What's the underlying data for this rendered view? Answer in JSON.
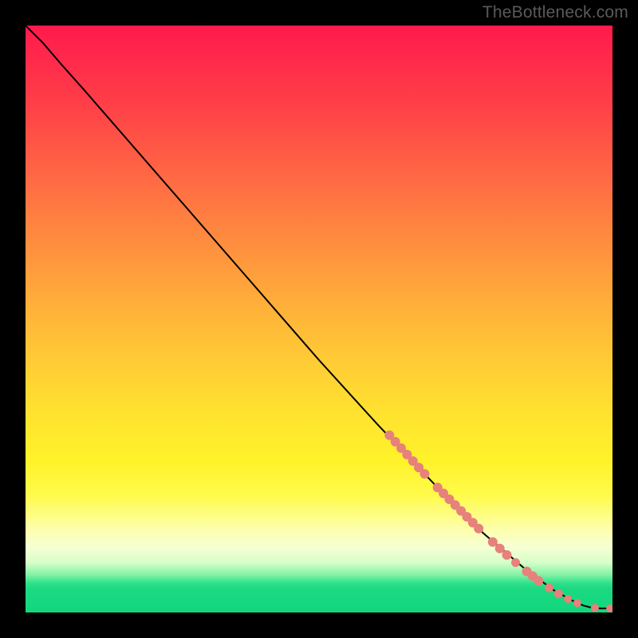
{
  "watermark_text": "TheBottleneck.com",
  "chart_data": {
    "type": "line",
    "title": "",
    "xlabel": "",
    "ylabel": "",
    "xlim": [
      0,
      100
    ],
    "ylim": [
      0,
      100
    ],
    "series": [
      {
        "name": "curve",
        "x": [
          0,
          3,
          6,
          10,
          20,
          30,
          40,
          50,
          60,
          70,
          78,
          85,
          90,
          93,
          95,
          96.5,
          98,
          100
        ],
        "y": [
          100,
          97,
          93.5,
          89,
          77.5,
          66,
          54.5,
          43,
          32,
          21.5,
          13.5,
          7.5,
          3.8,
          2.1,
          1.2,
          0.8,
          0.7,
          0.7
        ]
      }
    ],
    "points": {
      "name": "highlighted-points",
      "color": "#e6817b",
      "data": [
        {
          "x": 62.0,
          "y": 30.2,
          "r": 6
        },
        {
          "x": 63.0,
          "y": 29.1,
          "r": 6
        },
        {
          "x": 64.0,
          "y": 28.0,
          "r": 6
        },
        {
          "x": 65.0,
          "y": 26.9,
          "r": 6
        },
        {
          "x": 66.0,
          "y": 25.8,
          "r": 6
        },
        {
          "x": 67.0,
          "y": 24.7,
          "r": 6
        },
        {
          "x": 68.0,
          "y": 23.6,
          "r": 6
        },
        {
          "x": 70.2,
          "y": 21.3,
          "r": 6
        },
        {
          "x": 71.2,
          "y": 20.3,
          "r": 6
        },
        {
          "x": 72.2,
          "y": 19.3,
          "r": 6
        },
        {
          "x": 73.2,
          "y": 18.3,
          "r": 6
        },
        {
          "x": 74.2,
          "y": 17.3,
          "r": 6
        },
        {
          "x": 75.2,
          "y": 16.3,
          "r": 6
        },
        {
          "x": 76.2,
          "y": 15.3,
          "r": 6
        },
        {
          "x": 77.2,
          "y": 14.3,
          "r": 6
        },
        {
          "x": 79.6,
          "y": 12.0,
          "r": 6
        },
        {
          "x": 80.8,
          "y": 10.9,
          "r": 6
        },
        {
          "x": 82.0,
          "y": 9.8,
          "r": 6
        },
        {
          "x": 83.5,
          "y": 8.5,
          "r": 5.5
        },
        {
          "x": 85.4,
          "y": 7.0,
          "r": 6
        },
        {
          "x": 86.4,
          "y": 6.2,
          "r": 6
        },
        {
          "x": 87.4,
          "y": 5.4,
          "r": 6
        },
        {
          "x": 89.2,
          "y": 4.2,
          "r": 5.5
        },
        {
          "x": 90.8,
          "y": 3.2,
          "r": 5.5
        },
        {
          "x": 92.4,
          "y": 2.3,
          "r": 5
        },
        {
          "x": 94.0,
          "y": 1.6,
          "r": 5
        },
        {
          "x": 97.0,
          "y": 0.8,
          "r": 5
        },
        {
          "x": 99.6,
          "y": 0.7,
          "r": 5
        },
        {
          "x": 100.6,
          "y": 0.7,
          "r": 5
        }
      ]
    },
    "background_gradient": {
      "top": "#ff1a4b",
      "mid": "#ffe22f",
      "bottom": "#12d77e"
    }
  }
}
